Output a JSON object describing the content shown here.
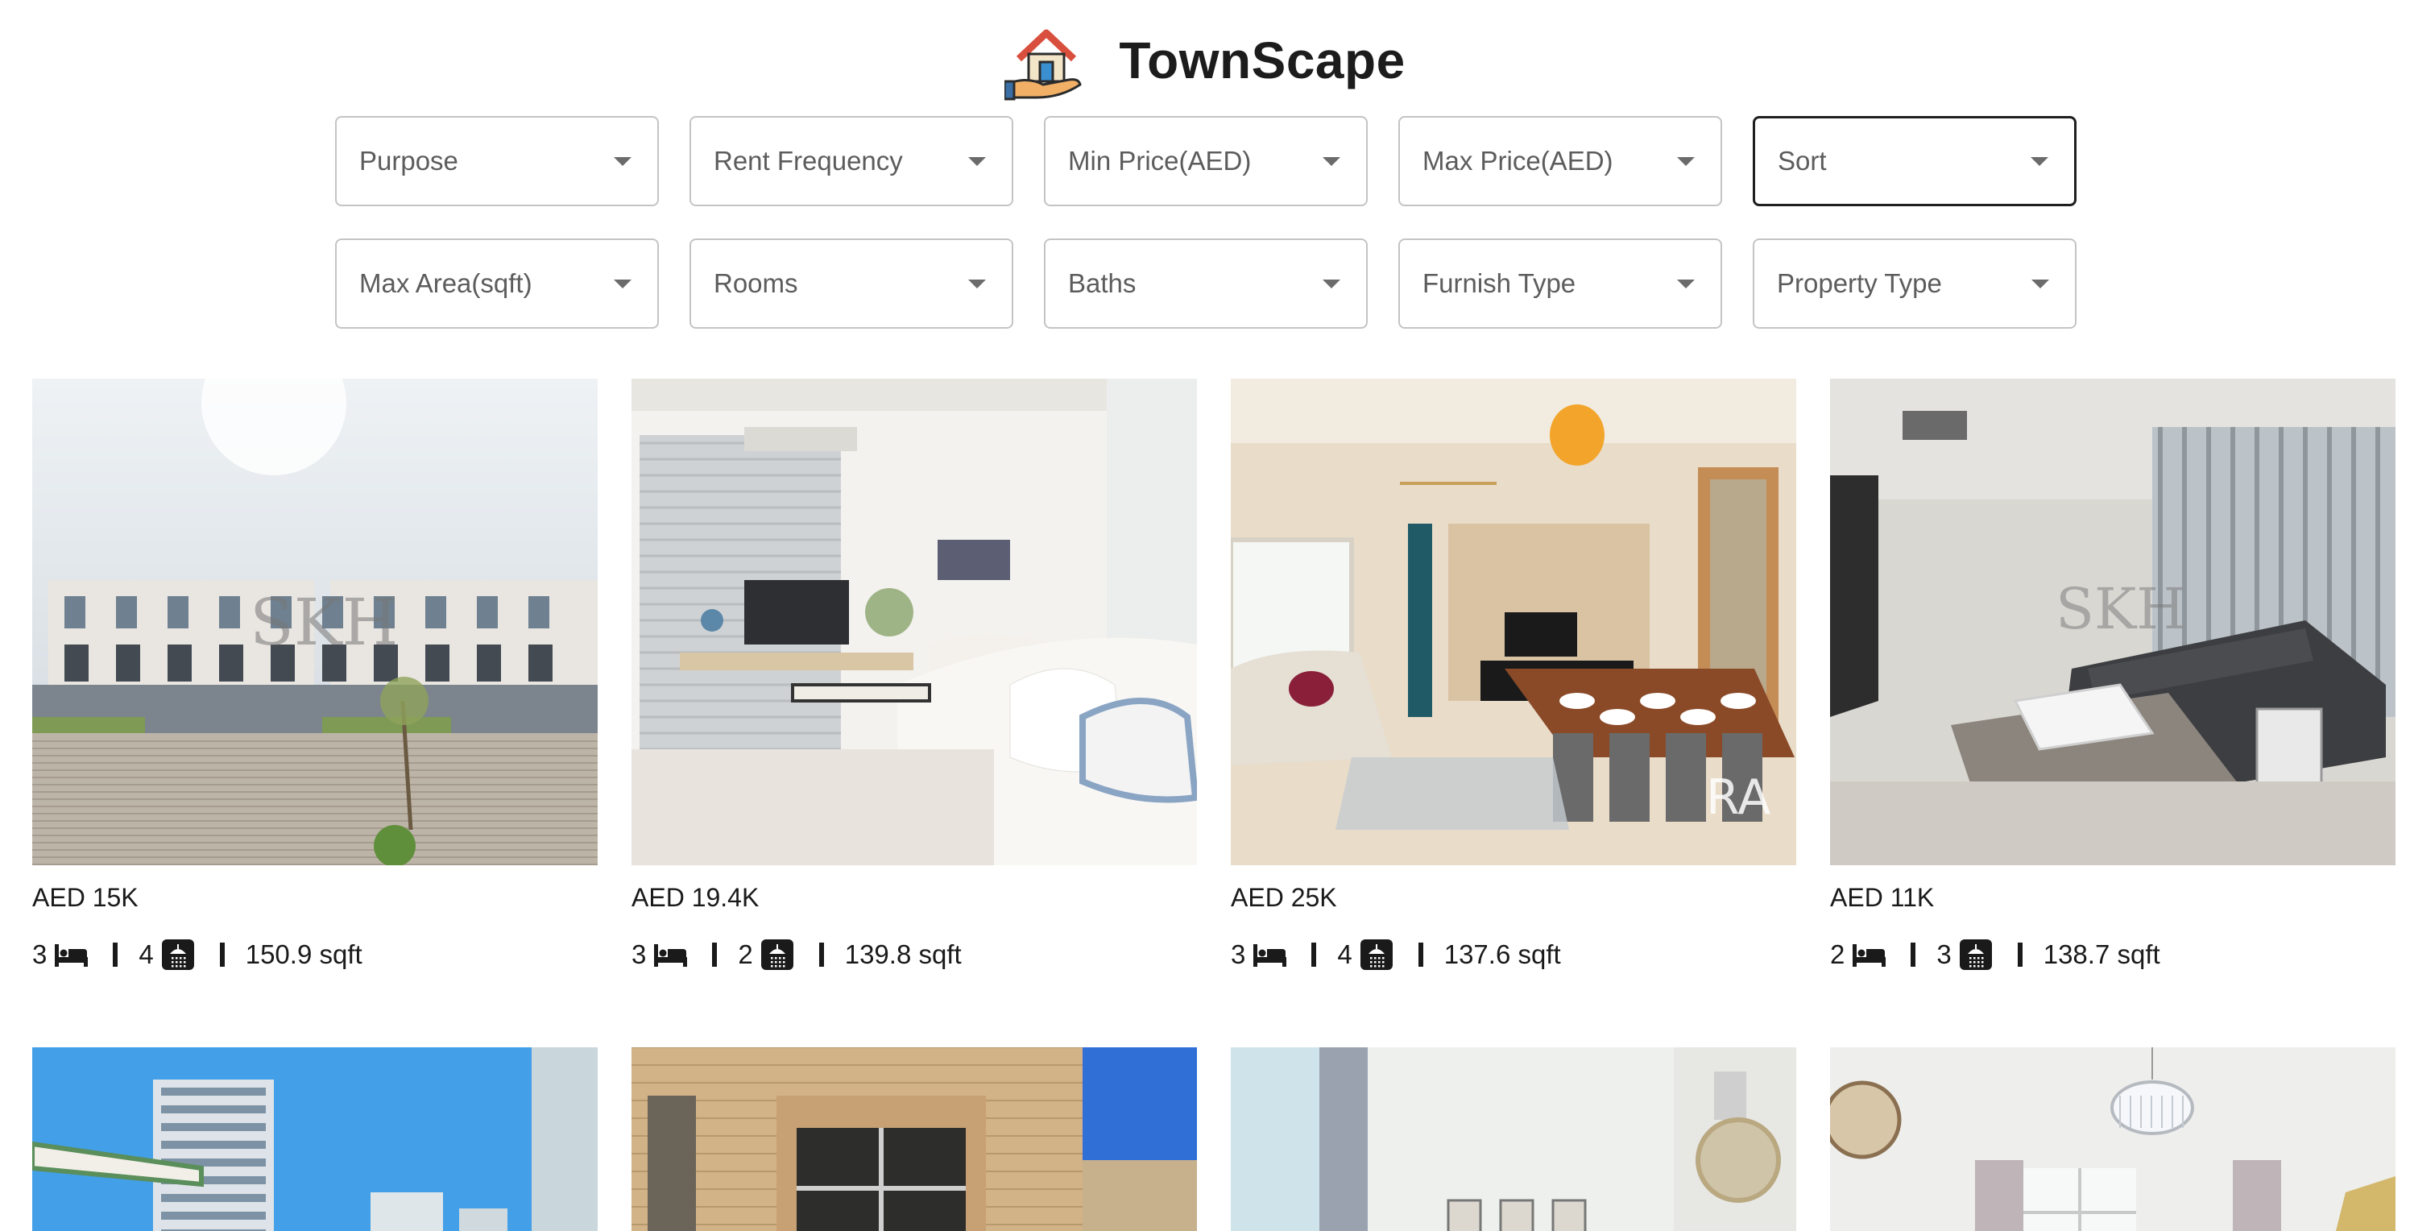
{
  "app": {
    "brand": "TownScape",
    "logo_icon": "house-in-hand-icon"
  },
  "filters": [
    {
      "label": "Purpose",
      "active": false
    },
    {
      "label": "Rent Frequency",
      "active": false
    },
    {
      "label": "Min Price(AED)",
      "active": false
    },
    {
      "label": "Max Price(AED)",
      "active": false
    },
    {
      "label": "Sort",
      "active": true
    },
    {
      "label": "Max Area(sqft)",
      "active": false
    },
    {
      "label": "Rooms",
      "active": false
    },
    {
      "label": "Baths",
      "active": false
    },
    {
      "label": "Furnish Type",
      "active": false
    },
    {
      "label": "Property Type",
      "active": false
    }
  ],
  "listings": [
    {
      "price": "AED 15K",
      "rooms": "3",
      "baths": "4",
      "area": "150.9 sqft",
      "photo": "townhouse-exterior"
    },
    {
      "price": "AED 19.4K",
      "rooms": "3",
      "baths": "2",
      "area": "139.8 sqft",
      "photo": "white-living-room"
    },
    {
      "price": "AED 25K",
      "rooms": "3",
      "baths": "4",
      "area": "137.6 sqft",
      "photo": "dining-living-room"
    },
    {
      "price": "AED 11K",
      "rooms": "2",
      "baths": "3",
      "area": "138.7 sqft",
      "photo": "grey-sofa-living-room"
    },
    {
      "photo": "apartment-towers"
    },
    {
      "photo": "stone-facade"
    },
    {
      "photo": "bright-interior"
    },
    {
      "photo": "chandelier-interior"
    }
  ],
  "icons": {
    "bed": "bed-icon",
    "bath": "shower-icon",
    "caret": "chevron-down-icon"
  }
}
